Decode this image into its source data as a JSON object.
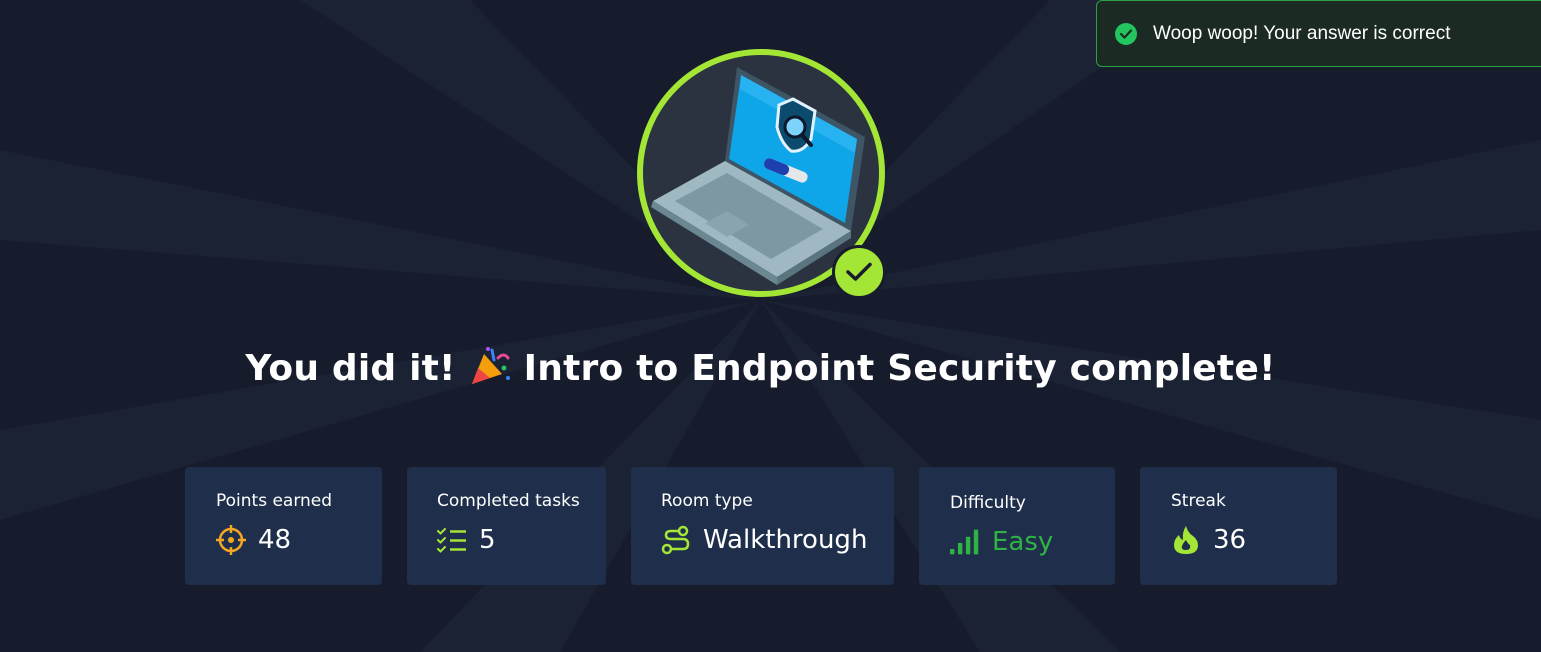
{
  "toast": {
    "message": "Woop woop! Your answer is correct",
    "icon": "check-circle-icon"
  },
  "badge": {
    "icon": "laptop-shield-icon",
    "status_icon": "checkmark-icon"
  },
  "heading": {
    "part1": "You did it!",
    "emoji": "party-popper-icon",
    "part2": "Intro to Endpoint Security complete!"
  },
  "stats": [
    {
      "label": "Points earned",
      "value": "48",
      "icon": "target-icon"
    },
    {
      "label": "Completed tasks",
      "value": "5",
      "icon": "checklist-icon"
    },
    {
      "label": "Room type",
      "value": "Walkthrough",
      "icon": "route-icon"
    },
    {
      "label": "Difficulty",
      "value": "Easy",
      "icon": "signal-bars-icon"
    },
    {
      "label": "Streak",
      "value": "36",
      "icon": "flame-icon"
    }
  ],
  "colors": {
    "background": "#161c2c",
    "card": "#1f2f4b",
    "accent": "#a3e635",
    "success": "#22c55e",
    "easy": "#2fb344",
    "points": "#f5a623"
  }
}
